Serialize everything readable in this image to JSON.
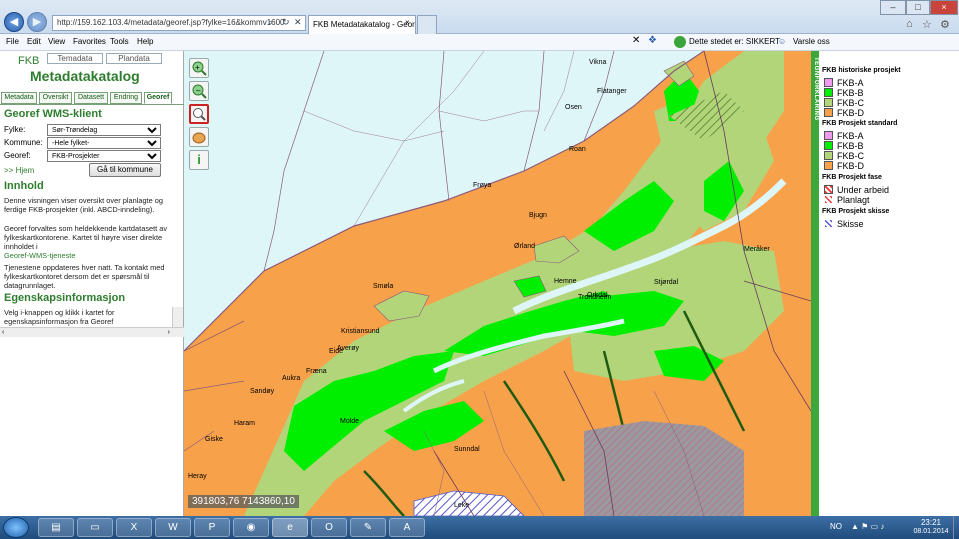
{
  "browser": {
    "address": "http://159.162.103.4/metadata/georef.jsp?fylke=16&kommv1600",
    "tab_active_label": "FKB Metadatakatalog - Geor...",
    "tab_close": "×",
    "search_glyph": "⌕",
    "menu": [
      "File",
      "Edit",
      "View",
      "Favorites",
      "Tools",
      "Help"
    ],
    "site_status": "Dette stedet er: SIKKERT",
    "warn_label": "Varsle oss",
    "window_min": "–",
    "window_max": "□",
    "window_close": "×"
  },
  "sidebar": {
    "logo": "FKB",
    "top_tabs": [
      "Temadata",
      "Plandata"
    ],
    "title": "Metadatakatalog",
    "tabs": [
      "Metadata",
      "Oversikt",
      "Datasett",
      "Endring",
      "Georef"
    ],
    "wms_heading": "Georef WMS-klient",
    "fylke_label": "Fylke:",
    "fylke_value": "Sør-Trøndelag",
    "kommune_label": "Kommune:",
    "kommune_value": "-Hele fylket-",
    "georef_label": "Georef:",
    "georef_value": "FKB-Prosjekter",
    "home_link": ">> Hjem",
    "goto_button": "Gå til kommune",
    "innhold_heading": "Innhold",
    "innhold_p1": "Denne visningen viser oversikt over planlagte og ferdige FKB-prosjekter (inkl. ABCD-inndeling).",
    "innhold_p2": "Georef forvaltes som heldekkende kartdatasett av fylkeskartkontorene. Kartet til høyre viser direkte innholdet i",
    "innhold_link": "Georef-WMS-tjeneste",
    "innhold_p3": "Tjenestene oppdateres hver natt. Ta kontakt med fylkeskartkontoret dersom det er spørsmål til datagrunnlaget.",
    "egenskap_heading": "Egenskapsinformasjon",
    "egenskap_text": "Velg i-knappen og klikk i kartet for egenskapsinformasjon fra Georef"
  },
  "map": {
    "coordinates": "391803,76 7143860,10",
    "place_labels": [
      "Vikna",
      "Flatanger",
      "Osen",
      "Roan",
      "Frøya",
      "Bjugn",
      "Ørland",
      "Smøla",
      "Kristiansund",
      "Averøy",
      "Eide",
      "Aukra",
      "Fræna",
      "Sandøy",
      "Haram",
      "Giske",
      "Molde",
      "Sunndal",
      "Heray",
      "Leke",
      "Hemne",
      "Orkdal",
      "Trondheim",
      "Meråker",
      "Stjørdal"
    ],
    "colors": {
      "sea": "#dff6f9",
      "fkb_a": "#ee9bee",
      "fkb_b": "#00ee00",
      "fkb_c": "#b2d57a",
      "fkb_d": "#f7a24b",
      "border": "#8b5a7a"
    }
  },
  "legend": {
    "side_tab": "TEGNFORKLARING",
    "sections": [
      {
        "title": "FKB historiske prosjekt",
        "items": [
          "FKB-A",
          "FKB-B",
          "FKB-C",
          "FKB-D"
        ]
      },
      {
        "title": "FKB Prosjekt standard",
        "items": [
          "FKB-A",
          "FKB-B",
          "FKB-C",
          "FKB-D"
        ]
      },
      {
        "title": "FKB Prosjekt fase",
        "items": [
          "Under arbeid",
          "Planlagt"
        ]
      },
      {
        "title": "FKB Prosjekt skisse",
        "items": [
          "Skisse"
        ]
      }
    ]
  },
  "taskbar": {
    "lang": "NO",
    "time": "23:21",
    "date": "08.01.2014"
  }
}
